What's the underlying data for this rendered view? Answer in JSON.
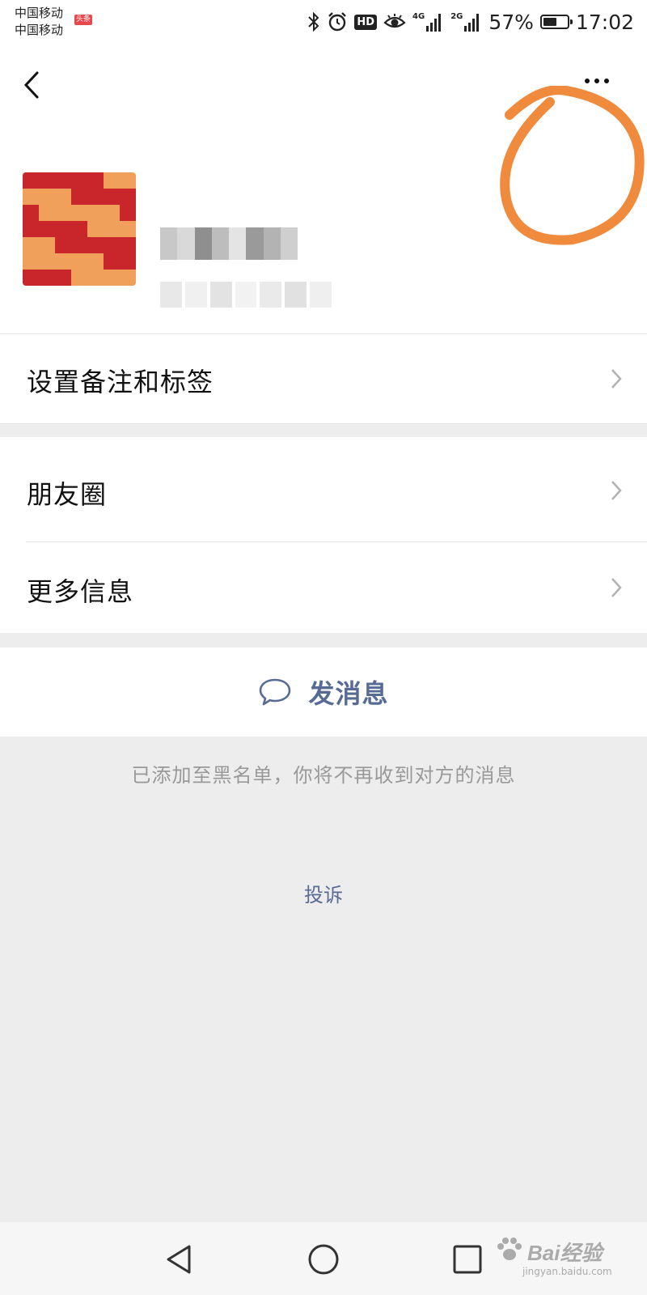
{
  "status_bar": {
    "carrier_1": "中国移动",
    "carrier_2": "中国移动",
    "badge": "头条",
    "hd_label": "HD",
    "network_1": "4G",
    "network_2": "2G",
    "battery_percent": "57%",
    "battery_level": 0.57,
    "time": "17:02"
  },
  "header": {
    "back_icon": "chevron-left-icon",
    "more_icon": "ellipsis-icon"
  },
  "profile": {
    "avatar_desc": "pixelated-avatar",
    "name_redacted": true
  },
  "menu": {
    "remark_tags": "设置备注和标签",
    "moments": "朋友圈",
    "more_info": "更多信息"
  },
  "actions": {
    "send_message": "发消息",
    "send_message_icon": "chat-bubble-icon"
  },
  "blacklist_note": "已添加至黑名单，你将不再收到对方的消息",
  "complain_link": "投诉",
  "watermark": {
    "brand": "Bai",
    "brand_cn": "经验",
    "url": "jingyan.baidu.com"
  },
  "colors": {
    "link": "#576b95",
    "background": "#ededed",
    "annotation": "#f08a3c"
  }
}
